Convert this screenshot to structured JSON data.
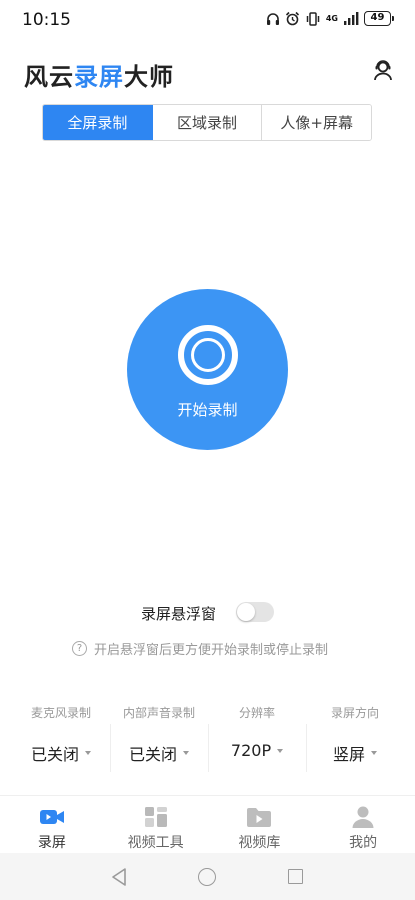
{
  "status_bar": {
    "time": "10:15",
    "network": "4G",
    "battery": "49"
  },
  "header": {
    "title_part1": "风云",
    "title_part2": "录屏",
    "title_part3": "大师",
    "accent_color": "#2e86f2"
  },
  "tabs": [
    {
      "label": "全屏录制",
      "active": true
    },
    {
      "label": "区域录制",
      "active": false
    },
    {
      "label": "人像+屏幕",
      "active": false
    }
  ],
  "record": {
    "label": "开始录制",
    "color": "#3c95f4"
  },
  "floating_window": {
    "label": "录屏悬浮窗",
    "enabled": false
  },
  "hint": {
    "icon": "?",
    "text": "开启悬浮窗后更方便开始录制或停止录制"
  },
  "settings": [
    {
      "title": "麦克风录制",
      "value": "已关闭"
    },
    {
      "title": "内部声音录制",
      "value": "已关闭"
    },
    {
      "title": "分辨率",
      "value": "720P"
    },
    {
      "title": "录屏方向",
      "value": "竖屏"
    }
  ],
  "bottom_nav": [
    {
      "label": "录屏",
      "icon": "video-camera-icon",
      "active": true
    },
    {
      "label": "视频工具",
      "icon": "tools-grid-icon",
      "active": false
    },
    {
      "label": "视频库",
      "icon": "video-folder-icon",
      "active": false
    },
    {
      "label": "我的",
      "icon": "user-icon",
      "active": false
    }
  ]
}
